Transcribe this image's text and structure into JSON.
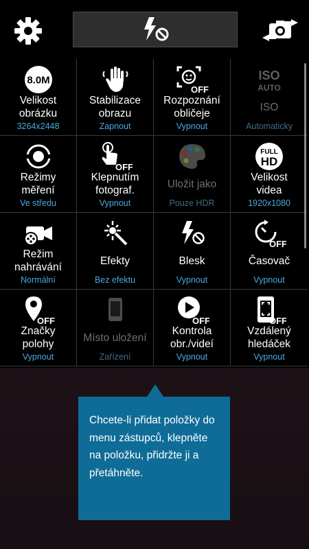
{
  "top_bar": {
    "settings_icon": "gear-icon",
    "flash_shortcut_icon": "flash-off-icon",
    "switch_camera_icon": "switch-camera-icon"
  },
  "grid": {
    "cells": [
      {
        "icon": "image-size-icon",
        "icon_text": "8.0M",
        "label": "Velikost\nobrázku",
        "value": "3264x2448",
        "enabled": true
      },
      {
        "icon": "stabilization-hand-icon",
        "label": "Stabilizace\nobrazu",
        "value": "Zapnout",
        "enabled": true
      },
      {
        "icon": "face-detection-off-icon",
        "icon_text": "OFF",
        "label": "Rozpoznání\nobličeje",
        "value": "Vypnout",
        "enabled": true
      },
      {
        "icon": "iso-icon",
        "icon_text": "ISO",
        "icon_subtext": "AUTO",
        "label": "ISO",
        "value": "Automaticky",
        "enabled": false
      },
      {
        "icon": "metering-icon",
        "label": "Režimy\nměření",
        "value": "Ve středu",
        "enabled": true
      },
      {
        "icon": "tap-shot-off-icon",
        "icon_text": "OFF",
        "label": "Klepnutím\nfotograf.",
        "value": "Vypnout",
        "enabled": true
      },
      {
        "icon": "palette-icon",
        "label": "Uložit jako",
        "value": "Pouze HDR",
        "enabled": false
      },
      {
        "icon": "video-size-icon",
        "icon_text": "FULL",
        "icon_subtext": "HD",
        "label": "Velikost\nvidea",
        "value": "1920x1080",
        "enabled": true
      },
      {
        "icon": "recording-mode-icon",
        "label": "Režim\nnahrávání",
        "value": "Normální",
        "enabled": true
      },
      {
        "icon": "effects-wand-icon",
        "label": "Efekty",
        "value": "Bez efektu",
        "enabled": true
      },
      {
        "icon": "flash-off-icon",
        "label": "Blesk",
        "value": "Vypnout",
        "enabled": true
      },
      {
        "icon": "timer-off-icon",
        "icon_text": "OFF",
        "label": "Časovač",
        "value": "Vypnout",
        "enabled": true
      },
      {
        "icon": "location-tag-off-icon",
        "icon_text": "OFF",
        "label": "Značky\npolohy",
        "value": "Vypnout",
        "enabled": true
      },
      {
        "icon": "phone-storage-icon",
        "label": "Místo uložení",
        "value": "Zařízení",
        "enabled": false
      },
      {
        "icon": "review-play-off-icon",
        "icon_text": "OFF",
        "label": "Kontrola\nobr./videí",
        "value": "Vypnout",
        "enabled": true
      },
      {
        "icon": "remote-viewfinder-off-icon",
        "icon_text": "OFF",
        "label": "Vzdálený\nhledáček",
        "value": "Vypnout",
        "enabled": true
      }
    ]
  },
  "tooltip": {
    "text": "Chcete-li přidat položky do menu zástupců, klepněte na položku, přidržte ji a přetáhněte."
  },
  "colors": {
    "value_blue": "#4aa9e4",
    "tooltip_bg": "#0f6c97",
    "grid_line": "#3a3a3a"
  }
}
